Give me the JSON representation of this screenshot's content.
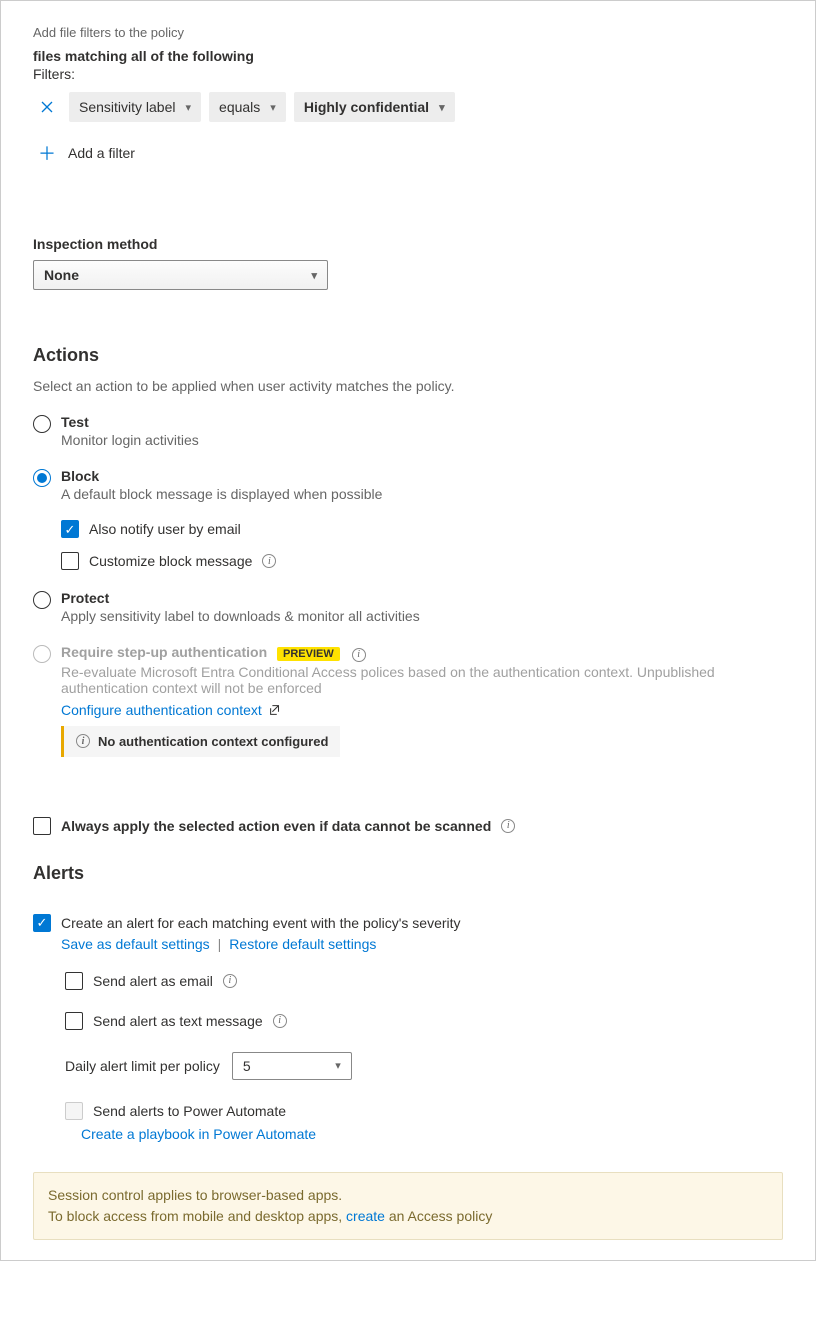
{
  "filters": {
    "hint": "Add file filters to the policy",
    "matching_label": "files matching all of the following",
    "filters_label": "Filters:",
    "filter1_field": "Sensitivity label",
    "filter1_op": "equals",
    "filter1_value": "Highly confidential",
    "add_filter": "Add a filter"
  },
  "inspection": {
    "label": "Inspection method",
    "value": "None"
  },
  "actions": {
    "heading": "Actions",
    "desc": "Select an action to be applied when user activity matches the policy.",
    "test_title": "Test",
    "test_sub": "Monitor login activities",
    "block_title": "Block",
    "block_sub": "A default block message is displayed when possible",
    "notify_email": "Also notify user by email",
    "customize_block": "Customize block message",
    "protect_title": "Protect",
    "protect_sub": "Apply sensitivity label to downloads & monitor all activities",
    "stepup_title": "Require step-up authentication",
    "preview_badge": "PREVIEW",
    "stepup_sub": "Re-evaluate Microsoft Entra Conditional Access polices based on the authentication context. Unpublished authentication context will not be enforced",
    "configure_link": "Configure authentication context",
    "no_auth_context": "No authentication context configured",
    "always_apply": "Always apply the selected action even if data cannot be scanned"
  },
  "alerts": {
    "heading": "Alerts",
    "create_alert": "Create an alert for each matching event with the policy's severity",
    "save_default": "Save as default settings",
    "restore_default": "Restore default settings",
    "send_email": "Send alert as email",
    "send_text": "Send alert as text message",
    "daily_limit_label": "Daily alert limit per policy",
    "daily_limit_value": "5",
    "send_power_automate": "Send alerts to Power Automate",
    "create_playbook": "Create a playbook in Power Automate"
  },
  "footer": {
    "line1": "Session control applies to browser-based apps.",
    "line2a": "To block access from mobile and desktop apps, ",
    "create_link": "create",
    "line2b": " an Access policy"
  }
}
